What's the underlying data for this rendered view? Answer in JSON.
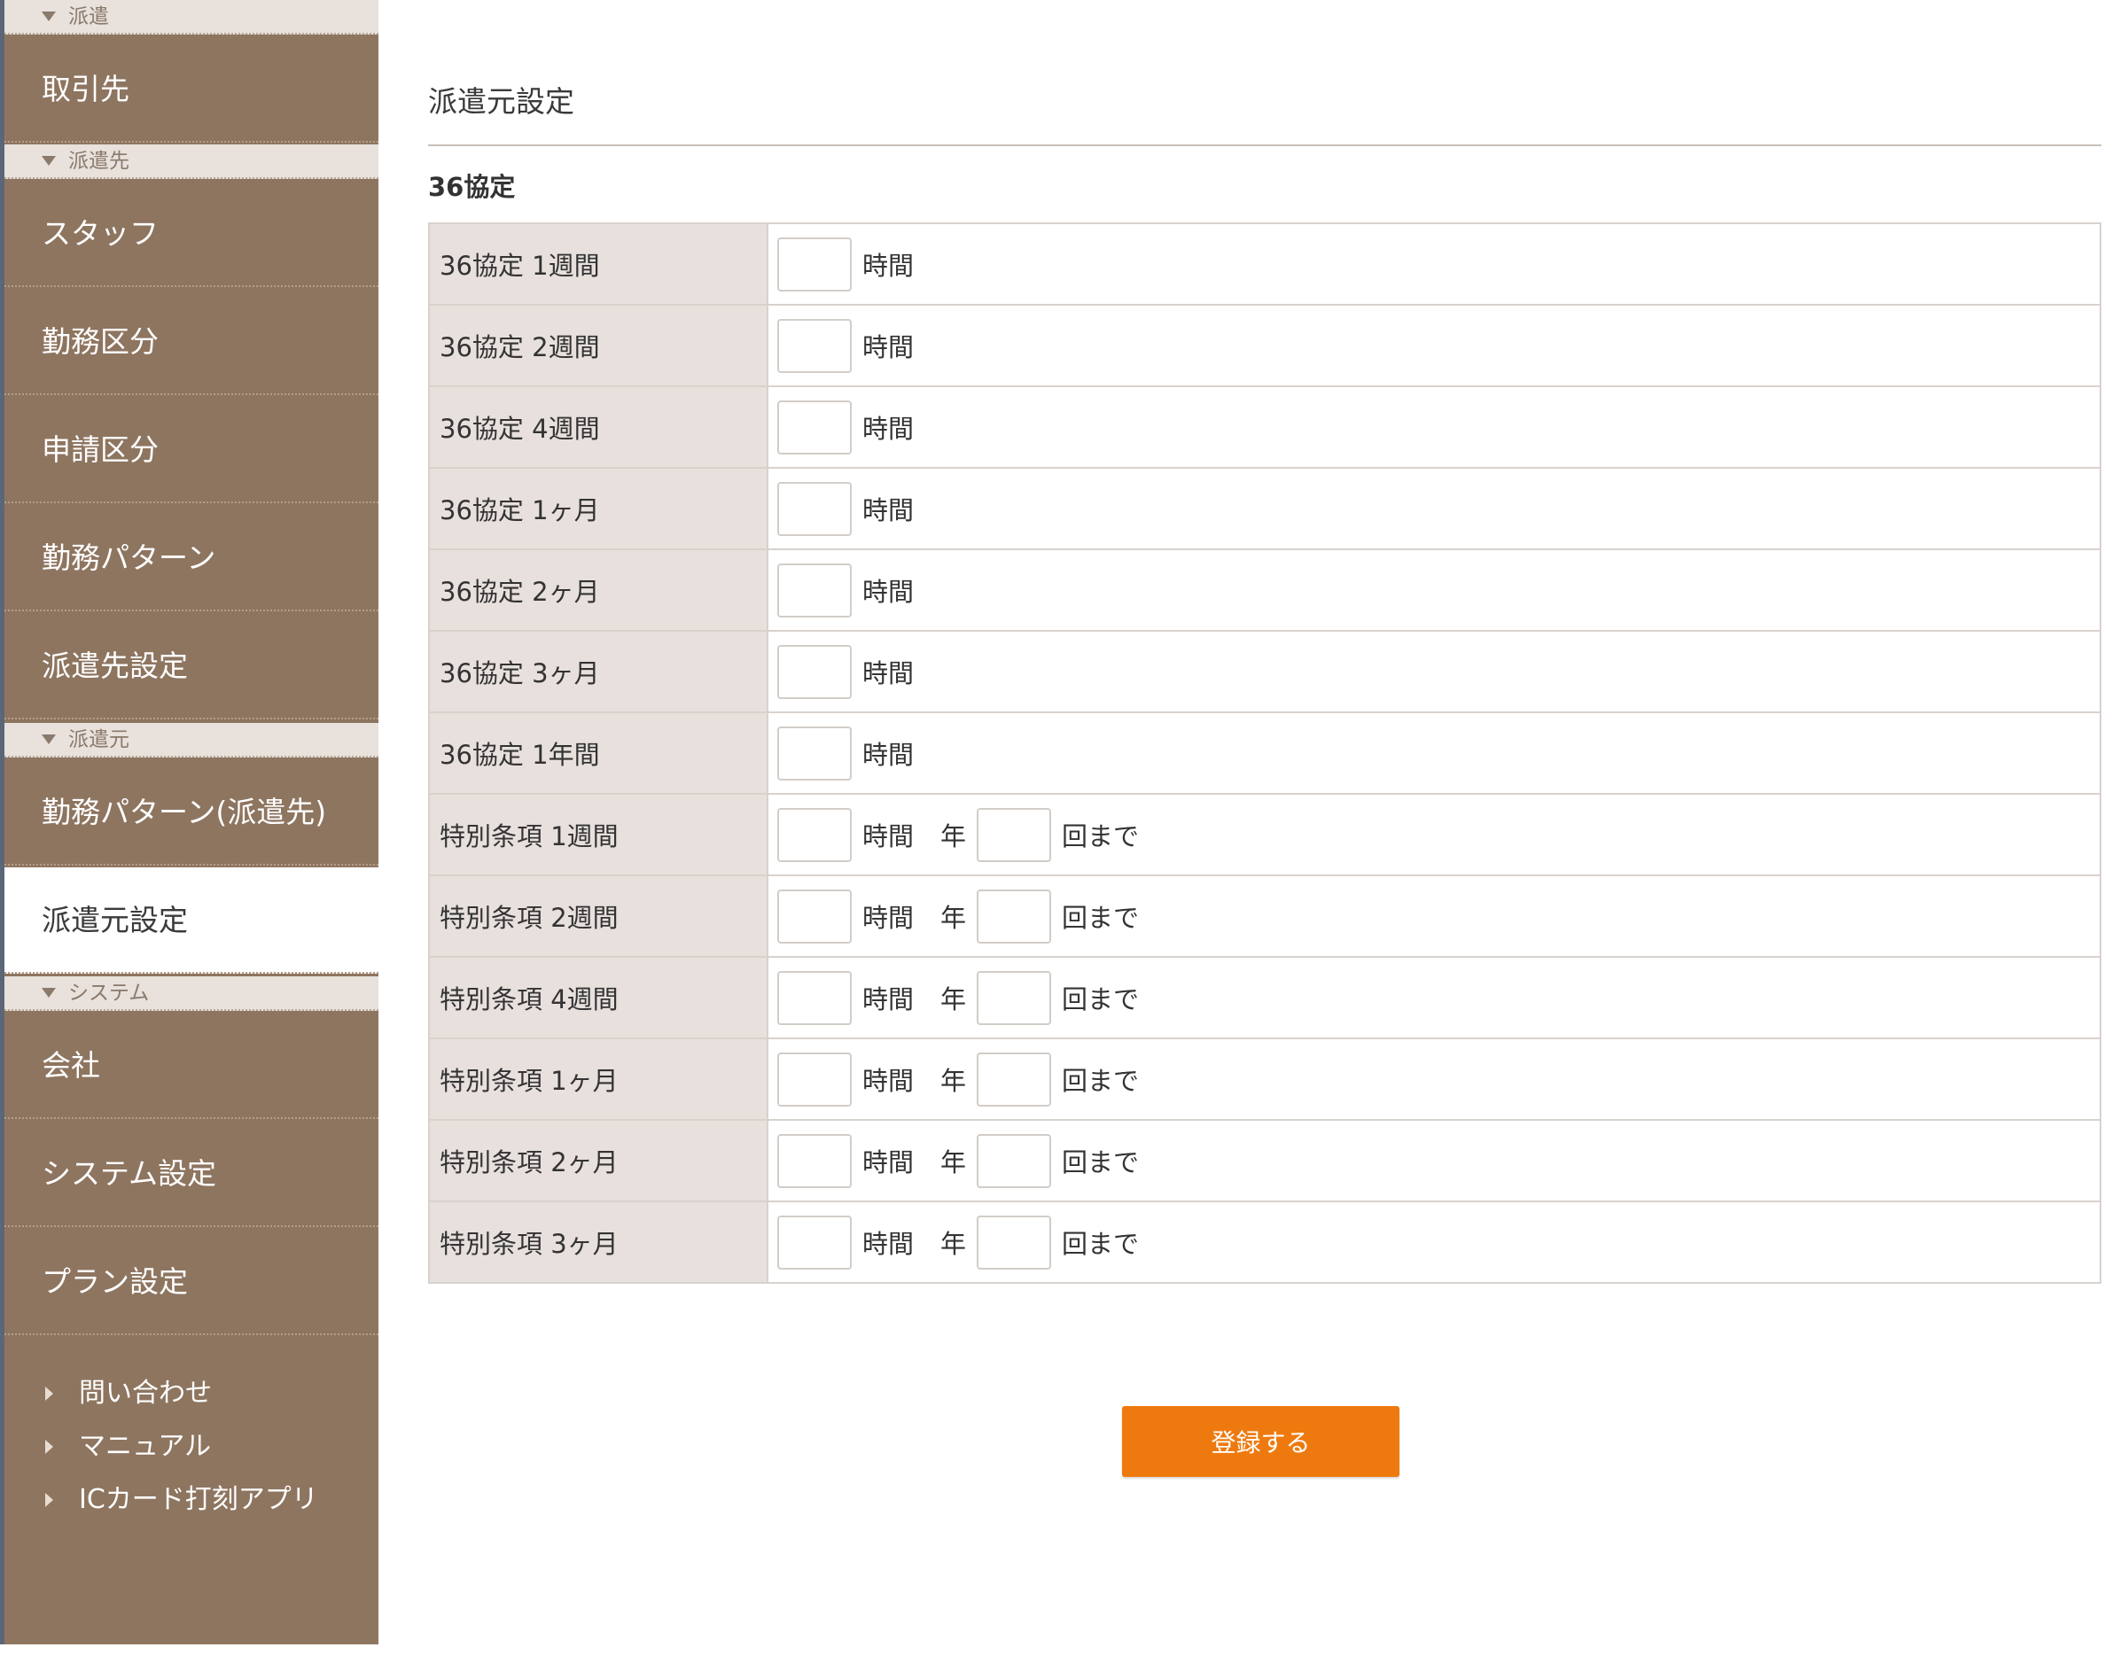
{
  "sidebar": {
    "sections": [
      {
        "header": "派遣",
        "items": [
          "取引先"
        ]
      },
      {
        "header": "派遣先",
        "items": [
          "スタッフ",
          "勤務区分",
          "申請区分",
          "勤務パターン",
          "派遣先設定"
        ]
      },
      {
        "header": "派遣元",
        "items": [
          "勤務パターン(派遣先)",
          "派遣元設定"
        ]
      },
      {
        "header": "システム",
        "items": [
          "会社",
          "システム設定",
          "プラン設定"
        ]
      }
    ],
    "active_item": "派遣元設定",
    "footer_links": [
      "問い合わせ",
      "マニュアル",
      "ICカード打刻アプリ"
    ]
  },
  "main": {
    "page_title": "派遣元設定",
    "section_title": "36協定",
    "rows": [
      {
        "label": "36協定 1週間",
        "unit": "時間"
      },
      {
        "label": "36協定 2週間",
        "unit": "時間"
      },
      {
        "label": "36協定 4週間",
        "unit": "時間"
      },
      {
        "label": "36協定 1ヶ月",
        "unit": "時間"
      },
      {
        "label": "36協定 2ヶ月",
        "unit": "時間"
      },
      {
        "label": "36協定 3ヶ月",
        "unit": "時間"
      },
      {
        "label": "36協定 1年間",
        "unit": "時間"
      },
      {
        "label": "特別条項 1週間",
        "unit": "時間",
        "year_label": "年",
        "times_suffix": "回まで"
      },
      {
        "label": "特別条項 2週間",
        "unit": "時間",
        "year_label": "年",
        "times_suffix": "回まで"
      },
      {
        "label": "特別条項 4週間",
        "unit": "時間",
        "year_label": "年",
        "times_suffix": "回まで"
      },
      {
        "label": "特別条項 1ヶ月",
        "unit": "時間",
        "year_label": "年",
        "times_suffix": "回まで"
      },
      {
        "label": "特別条項 2ヶ月",
        "unit": "時間",
        "year_label": "年",
        "times_suffix": "回まで"
      },
      {
        "label": "特別条項 3ヶ月",
        "unit": "時間",
        "year_label": "年",
        "times_suffix": "回まで"
      }
    ],
    "submit_label": "登録する"
  },
  "colors": {
    "sidebar_bg": "#8e7560",
    "section_header_bg": "#e8e1dc",
    "label_cell_bg": "#e7e0dd",
    "accent_button": "#ee7a0f"
  }
}
